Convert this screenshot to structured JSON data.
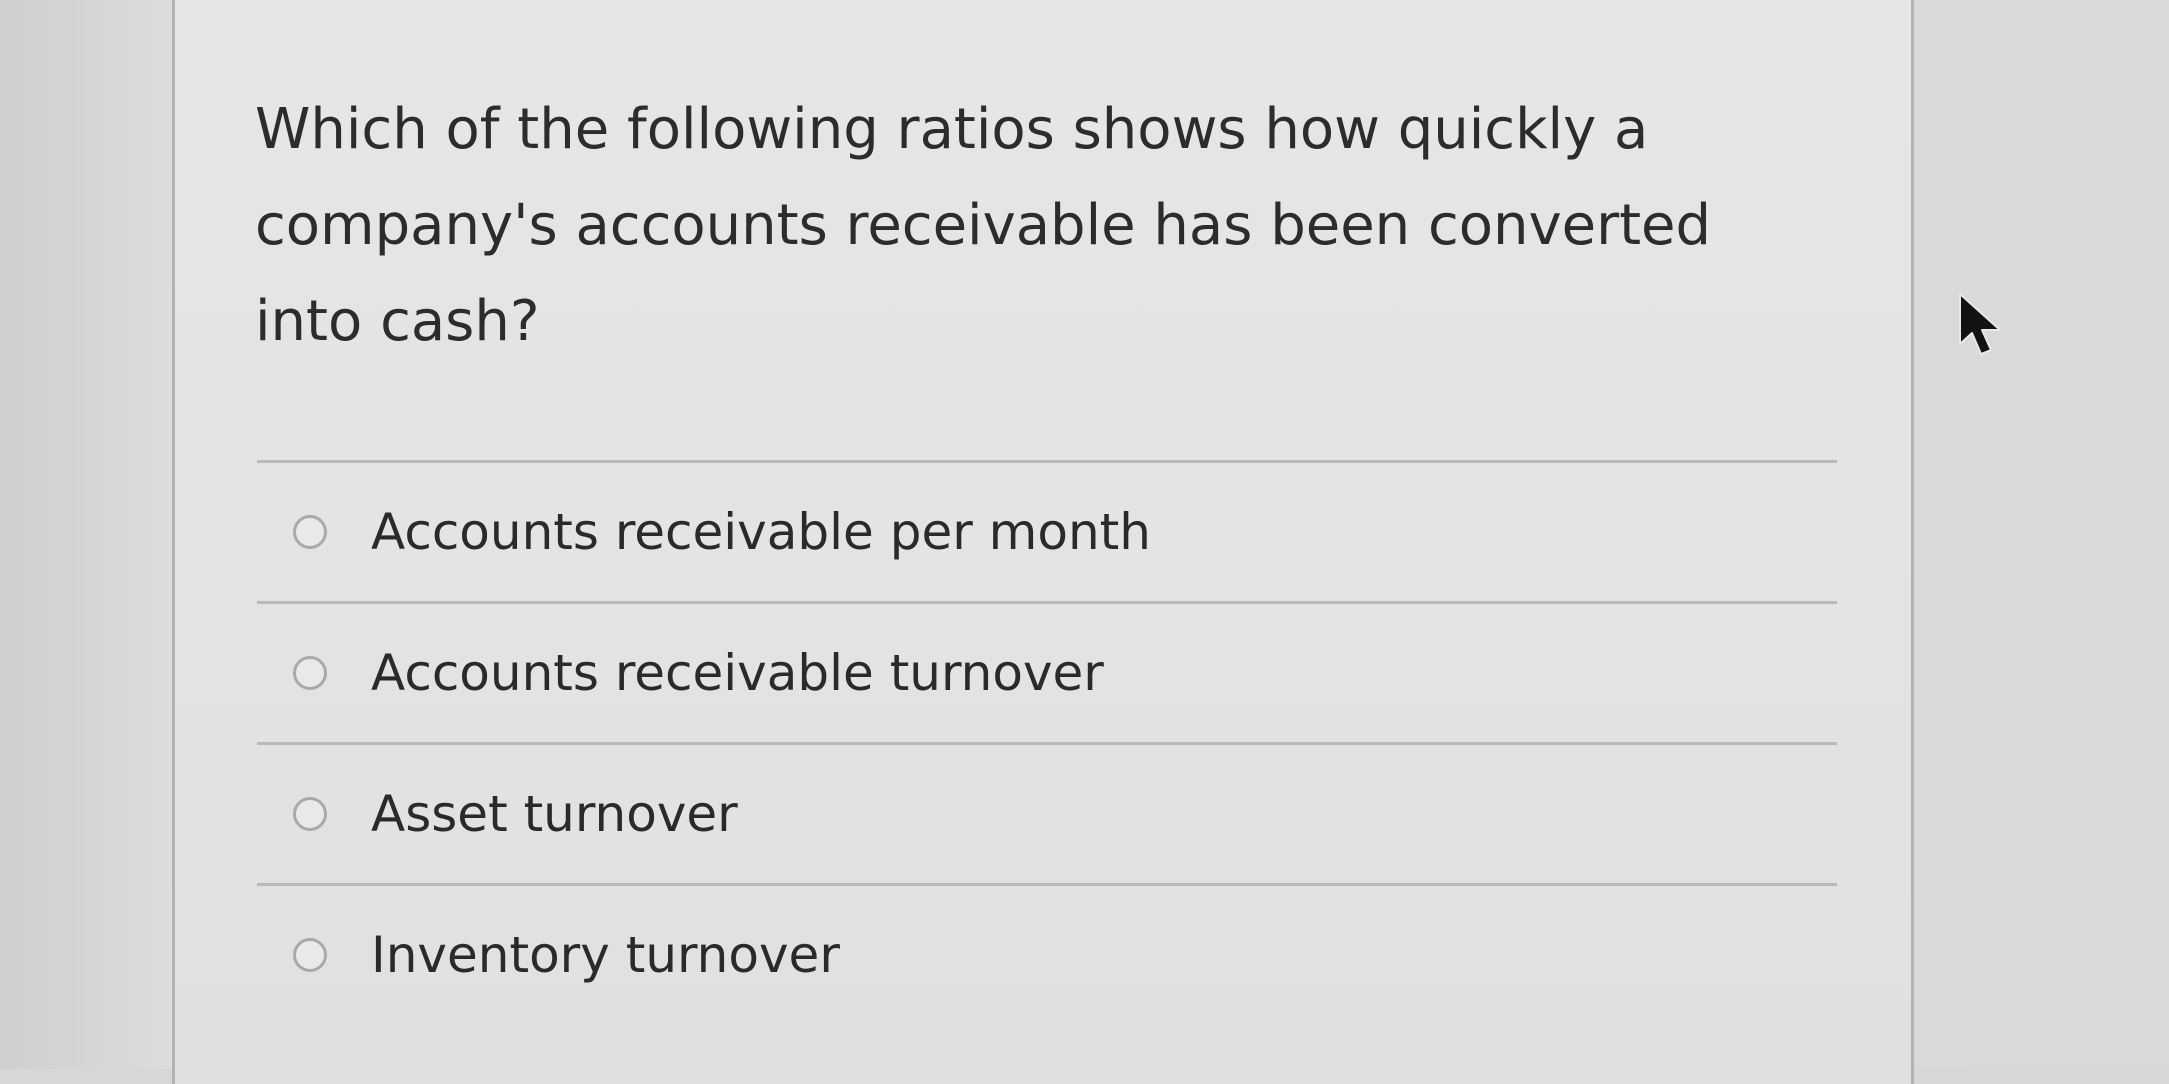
{
  "question": {
    "text": "Which of the following ratios shows how quickly a company's accounts receivable has been converted into cash?"
  },
  "options": [
    {
      "label": "Accounts receivable per month",
      "selected": false
    },
    {
      "label": "Accounts receivable turnover",
      "selected": false
    },
    {
      "label": "Asset turnover",
      "selected": false
    },
    {
      "label": "Inventory turnover",
      "selected": false
    }
  ],
  "cursor": {
    "icon": "arrow-pointer-icon"
  },
  "colors": {
    "panel": "#e4e4e2",
    "background": "#d7d7d5",
    "text": "#2c2c2c",
    "divider": "#b9b9b7",
    "radio_border": "#a9a9a7"
  }
}
